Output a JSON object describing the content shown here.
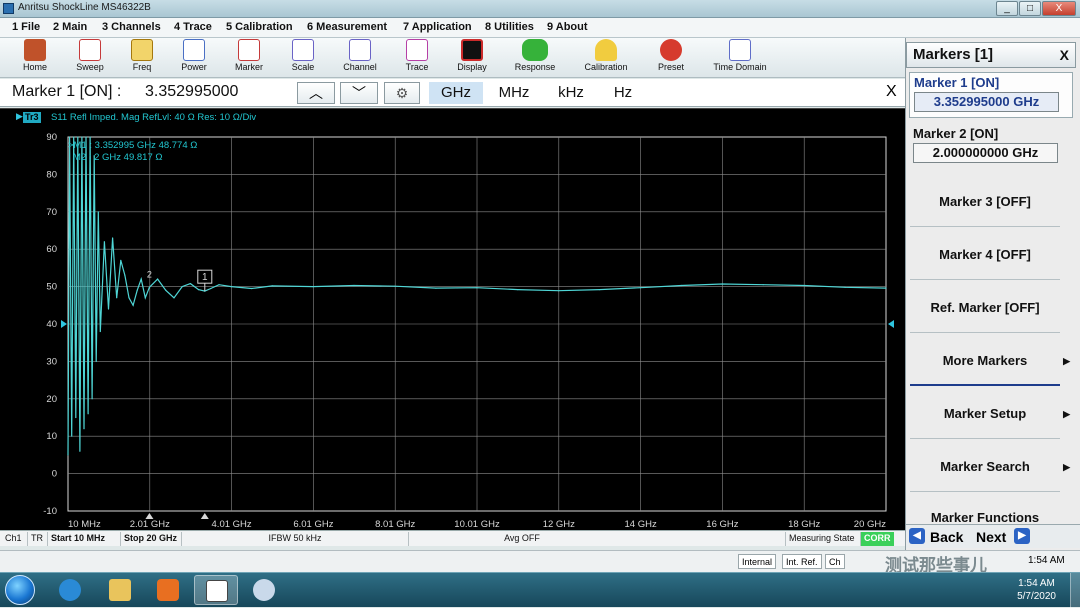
{
  "window": {
    "title": "Anritsu ShockLine MS46322B",
    "min": "_",
    "max": "□",
    "close": "X"
  },
  "menu": [
    "1 File",
    "2 Main",
    "3 Channels",
    "4 Trace",
    "5 Calibration",
    "6 Measurement",
    "7 Application",
    "8 Utilities",
    "9 About"
  ],
  "toolbar": [
    {
      "label": "Home",
      "icon": "home-icon",
      "color": "#c0522a"
    },
    {
      "label": "Sweep",
      "icon": "sweep-icon",
      "color": "#c53a3a"
    },
    {
      "label": "Freq",
      "icon": "freq-icon",
      "color": "#d8a21a"
    },
    {
      "label": "Power",
      "icon": "power-icon",
      "color": "#4a6fc4"
    },
    {
      "label": "Marker",
      "icon": "marker-icon",
      "color": "#c53a3a"
    },
    {
      "label": "Scale",
      "icon": "scale-icon",
      "color": "#6a63c6"
    },
    {
      "label": "Channel",
      "icon": "channel-icon",
      "color": "#6a63c6"
    },
    {
      "label": "Trace",
      "icon": "trace-icon",
      "color": "#b53fa6"
    },
    {
      "label": "Display",
      "icon": "display-icon",
      "color": "#cc2b2b"
    },
    {
      "label": "Response",
      "icon": "response-icon",
      "color": "#36b23a"
    },
    {
      "label": "Calibration",
      "icon": "calibration-icon",
      "color": "#e5b21a"
    },
    {
      "label": "Preset",
      "icon": "preset-icon",
      "color": "#d63b2d"
    },
    {
      "label": "Time Domain",
      "icon": "time-domain-icon",
      "color": "#5f6dc8"
    }
  ],
  "entry": {
    "label": "Marker 1 [ON]  :",
    "value": "3.352995000",
    "up": "︿",
    "down": "﹀",
    "settings": "⚙",
    "units": [
      "GHz",
      "MHz",
      "kHz",
      "Hz"
    ],
    "selected_unit": "GHz",
    "close": "X"
  },
  "trace": {
    "tag": "Tr3",
    "header": "S11 Refl Imped. Mag RefLvl: 40  Ω Res: 10  Ω/Div",
    "marker_readouts": [
      ">M1 :  3.352995 GHz  48.774  Ω",
      "M2 :  2 GHz  49.817  Ω"
    ],
    "marker_labels": [
      "1",
      "2"
    ]
  },
  "chart_data": {
    "type": "line",
    "title": "",
    "ylim": [
      -10,
      90
    ],
    "xlim_ghz": [
      0.01,
      20
    ],
    "y_ticks": [
      "90",
      "80",
      "70",
      "60",
      "50",
      "40",
      "30",
      "20",
      "10",
      "0",
      "-10"
    ],
    "x_ticks": [
      "10 MHz",
      "2.01 GHz",
      "4.01 GHz",
      "6.01 GHz",
      "8.01 GHz",
      "10.01 GHz",
      "12 GHz",
      "14 GHz",
      "16 GHz",
      "18 GHz",
      "20 GHz"
    ],
    "ref_level": 40,
    "grid": true,
    "trace_color": "#4fd6d6",
    "series": [
      {
        "name": "S11 Refl Imped. Mag",
        "x": [
          0.01,
          0.05,
          0.1,
          0.15,
          0.2,
          0.25,
          0.3,
          0.35,
          0.4,
          0.45,
          0.5,
          0.55,
          0.6,
          0.65,
          0.7,
          0.75,
          0.8,
          0.9,
          1.0,
          1.1,
          1.2,
          1.3,
          1.4,
          1.5,
          1.6,
          1.7,
          1.8,
          1.9,
          2.0,
          2.2,
          2.4,
          2.6,
          2.8,
          3.0,
          3.2,
          3.353,
          3.5,
          3.7,
          4.0,
          4.5,
          5,
          6,
          7,
          8,
          9,
          10,
          11,
          12,
          13,
          14,
          15,
          16,
          17,
          18,
          19,
          20
        ],
        "y": [
          5,
          90,
          10,
          90,
          15,
          90,
          6,
          90,
          12,
          90,
          16,
          90,
          20,
          85,
          30,
          70,
          38,
          62,
          44,
          63,
          47,
          57,
          53,
          47,
          45,
          49,
          52,
          47,
          49.8,
          52,
          49,
          47,
          50,
          50.8,
          49.2,
          48.8,
          49.5,
          50.5,
          50,
          49.5,
          50.2,
          50,
          50.3,
          50.1,
          49.6,
          49.7,
          49.2,
          48.9,
          49.2,
          49.7,
          50.3,
          50.7,
          50.5,
          50.3,
          49.8,
          49.6
        ]
      }
    ],
    "markers": [
      {
        "id": "1",
        "x": 3.352995,
        "y": 48.774
      },
      {
        "id": "2",
        "x": 2.0,
        "y": 49.817
      }
    ]
  },
  "status": {
    "ch": "Ch1",
    "tr": "TR",
    "start": "Start 10 MHz",
    "stop": "Stop 20 GHz",
    "ifbw": "IFBW 50 kHz",
    "avg": "Avg OFF",
    "measuring": "Measuring State",
    "corr": "CORR",
    "internal": "Internal",
    "intref": "Int. Ref.",
    "ch2": "Ch"
  },
  "side": {
    "title": "Markers [1]",
    "close": "X",
    "marker1": {
      "label": "Marker 1 [ON]",
      "value": "3.352995000 GHz"
    },
    "marker2": {
      "label": "Marker 2 [ON]",
      "value": "2.000000000 GHz"
    },
    "buttons": [
      "Marker 3 [OFF]",
      "Marker 4 [OFF]",
      "Ref. Marker [OFF]",
      "More Markers",
      "Marker Setup",
      "Marker Search",
      "Marker Functions"
    ],
    "back": "Back",
    "next": "Next"
  },
  "watermark": "测试那些事儿",
  "taskbar": {
    "time": "1:54 AM",
    "date": "5/7/2020",
    "status_time": "1:54 AM"
  }
}
